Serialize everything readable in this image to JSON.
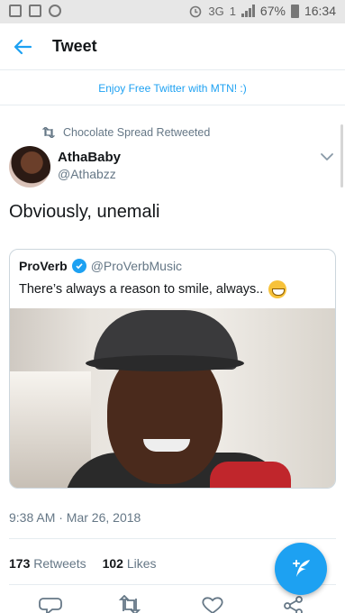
{
  "status_bar": {
    "network": "3G",
    "sim": "1",
    "battery": "67%",
    "time": "16:34"
  },
  "app_bar": {
    "title": "Tweet",
    "back_icon": "arrow-left-icon"
  },
  "promo": {
    "text": "Enjoy Free Twitter with MTN! :)"
  },
  "tweet": {
    "retweet_label": "Chocolate Spread Retweeted",
    "author_name": "AthaBaby",
    "author_handle": "@Athabzz",
    "text": "Obviously, unemali",
    "timestamp": "9:38 AM · Mar 26, 2018",
    "retweets_count": "173",
    "retweets_label": "Retweets",
    "likes_count": "102",
    "likes_label": "Likes"
  },
  "quoted_tweet": {
    "author_name": "ProVerb",
    "author_handle": "@ProVerbMusic",
    "text": "There’s always a reason to smile, always.."
  },
  "colors": {
    "accent": "#1da1f2",
    "secondary_text": "#657786",
    "border": "#e6ecf0"
  }
}
